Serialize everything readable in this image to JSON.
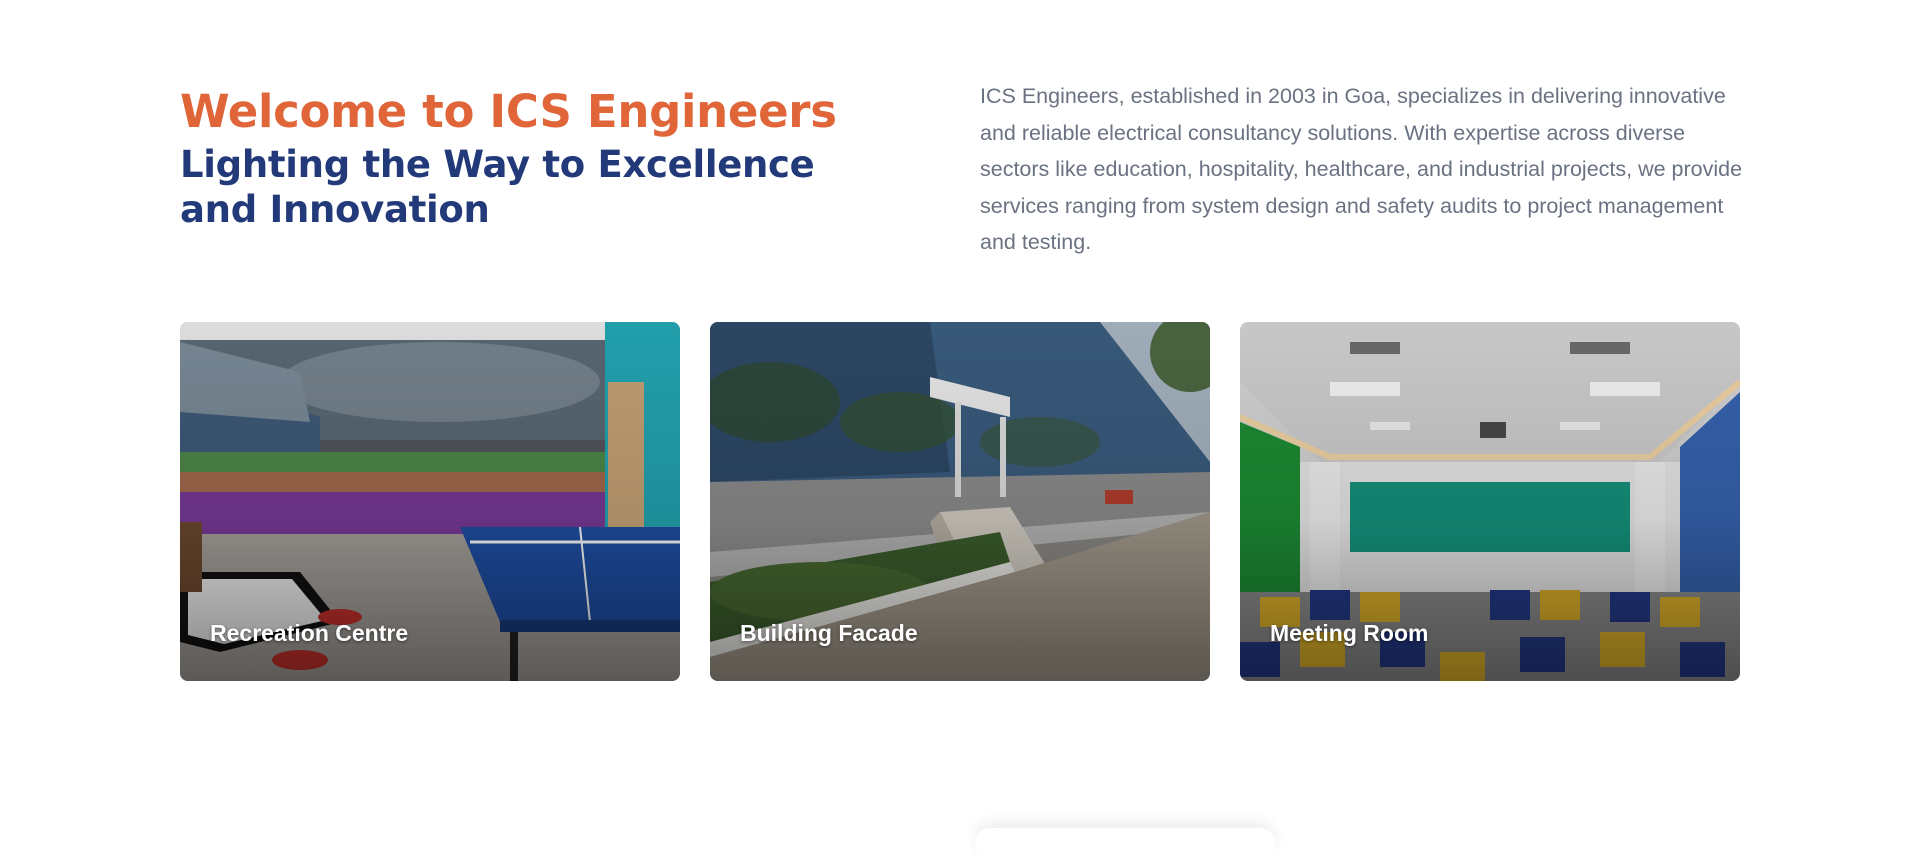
{
  "intro": {
    "welcome": "Welcome to ICS Engineers",
    "tagline": "Lighting the Way to Excellence and Innovation",
    "description": "ICS Engineers, established in 2003 in Goa, specializes in delivering innovative and reliable electrical consultancy solutions. With expertise across diverse sectors like education, hospitality, healthcare, and industrial projects, we provide services ranging from system design and safety audits to project management and testing."
  },
  "gallery": [
    {
      "label": "Recreation Centre",
      "image": "recreation-centre-photo"
    },
    {
      "label": "Building Facade",
      "image": "building-facade-photo"
    },
    {
      "label": "Meeting Room",
      "image": "meeting-room-photo"
    }
  ],
  "colors": {
    "accent_orange": "#e0663a",
    "brand_navy": "#233a7a",
    "body_text": "#6a7282"
  }
}
